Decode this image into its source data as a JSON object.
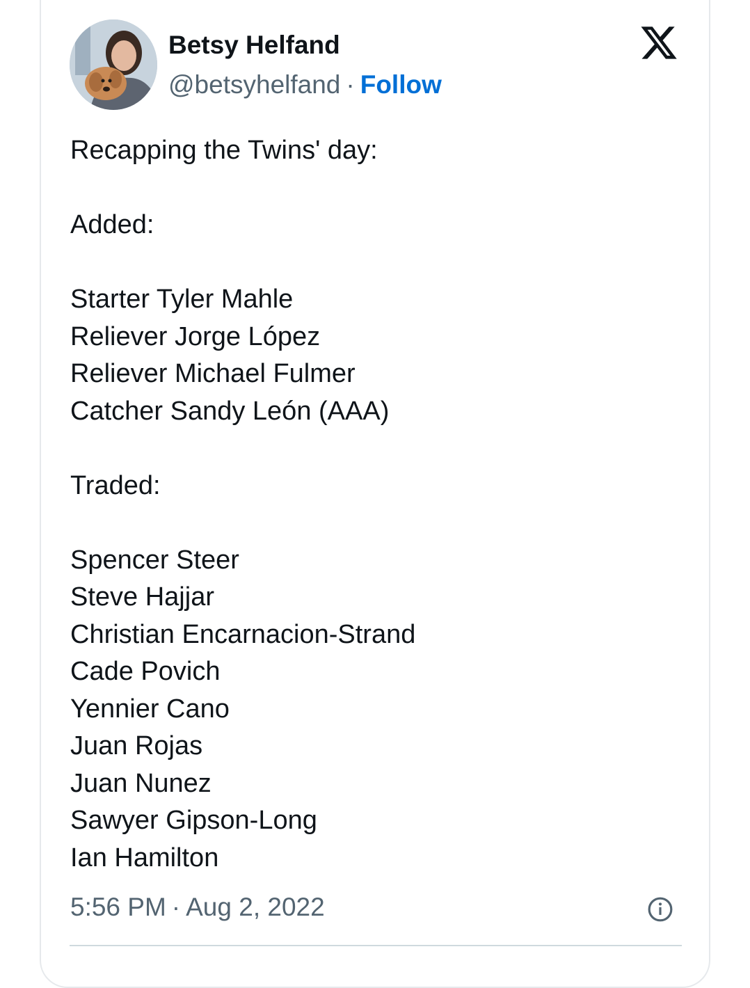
{
  "author": {
    "name": "Betsy Helfand",
    "handle": "@betsyhelfand",
    "separator": "·",
    "follow_label": "Follow"
  },
  "icons": {
    "avatar": "profile-photo-woman-with-dog",
    "platform_logo": "x-logo-icon",
    "info": "info-circle-icon"
  },
  "tweet": {
    "intro": "Recapping the Twins' day:",
    "added_heading": "Added:",
    "added": [
      "Starter Tyler Mahle",
      "Reliever Jorge López",
      "Reliever Michael Fulmer",
      "Catcher Sandy León (AAA)"
    ],
    "traded_heading": "Traded:",
    "traded": [
      "Spencer Steer",
      "Steve Hajjar",
      "Christian Encarnacion-Strand",
      "Cade Povich",
      "Yennier Cano",
      "Juan Rojas",
      "Juan Nunez",
      "Sawyer Gipson-Long",
      "Ian Hamilton"
    ]
  },
  "meta": {
    "time": "5:56 PM",
    "separator": "·",
    "date": "Aug 2, 2022"
  },
  "colors": {
    "text": "#0f1419",
    "muted": "#536471",
    "link": "#006fd6",
    "border": "#e6e9ec"
  }
}
